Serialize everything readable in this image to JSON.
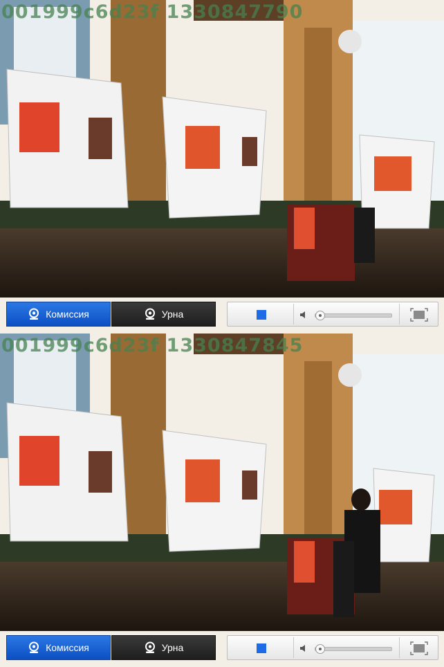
{
  "colors": {
    "active_tab": "#1d63d8",
    "inactive_tab": "#2a2a2a",
    "stop_button": "#1e6be6",
    "overlay_text": "#468250"
  },
  "frames": [
    {
      "overlay_id": "001999c6d23f 1330847790",
      "cameras": {
        "commission_label": "Комиссия",
        "urn_label": "Урна"
      },
      "active_camera": "commission",
      "volume_level": 0.05,
      "icons": [
        "webcam-icon",
        "stop-icon",
        "volume-icon",
        "fullscreen-icon"
      ]
    },
    {
      "overlay_id": "001999c6d23f 1330847845",
      "cameras": {
        "commission_label": "Комиссия",
        "urn_label": "Урна"
      },
      "active_camera": "commission",
      "volume_level": 0.05,
      "icons": [
        "webcam-icon",
        "stop-icon",
        "volume-icon",
        "fullscreen-icon"
      ]
    }
  ]
}
